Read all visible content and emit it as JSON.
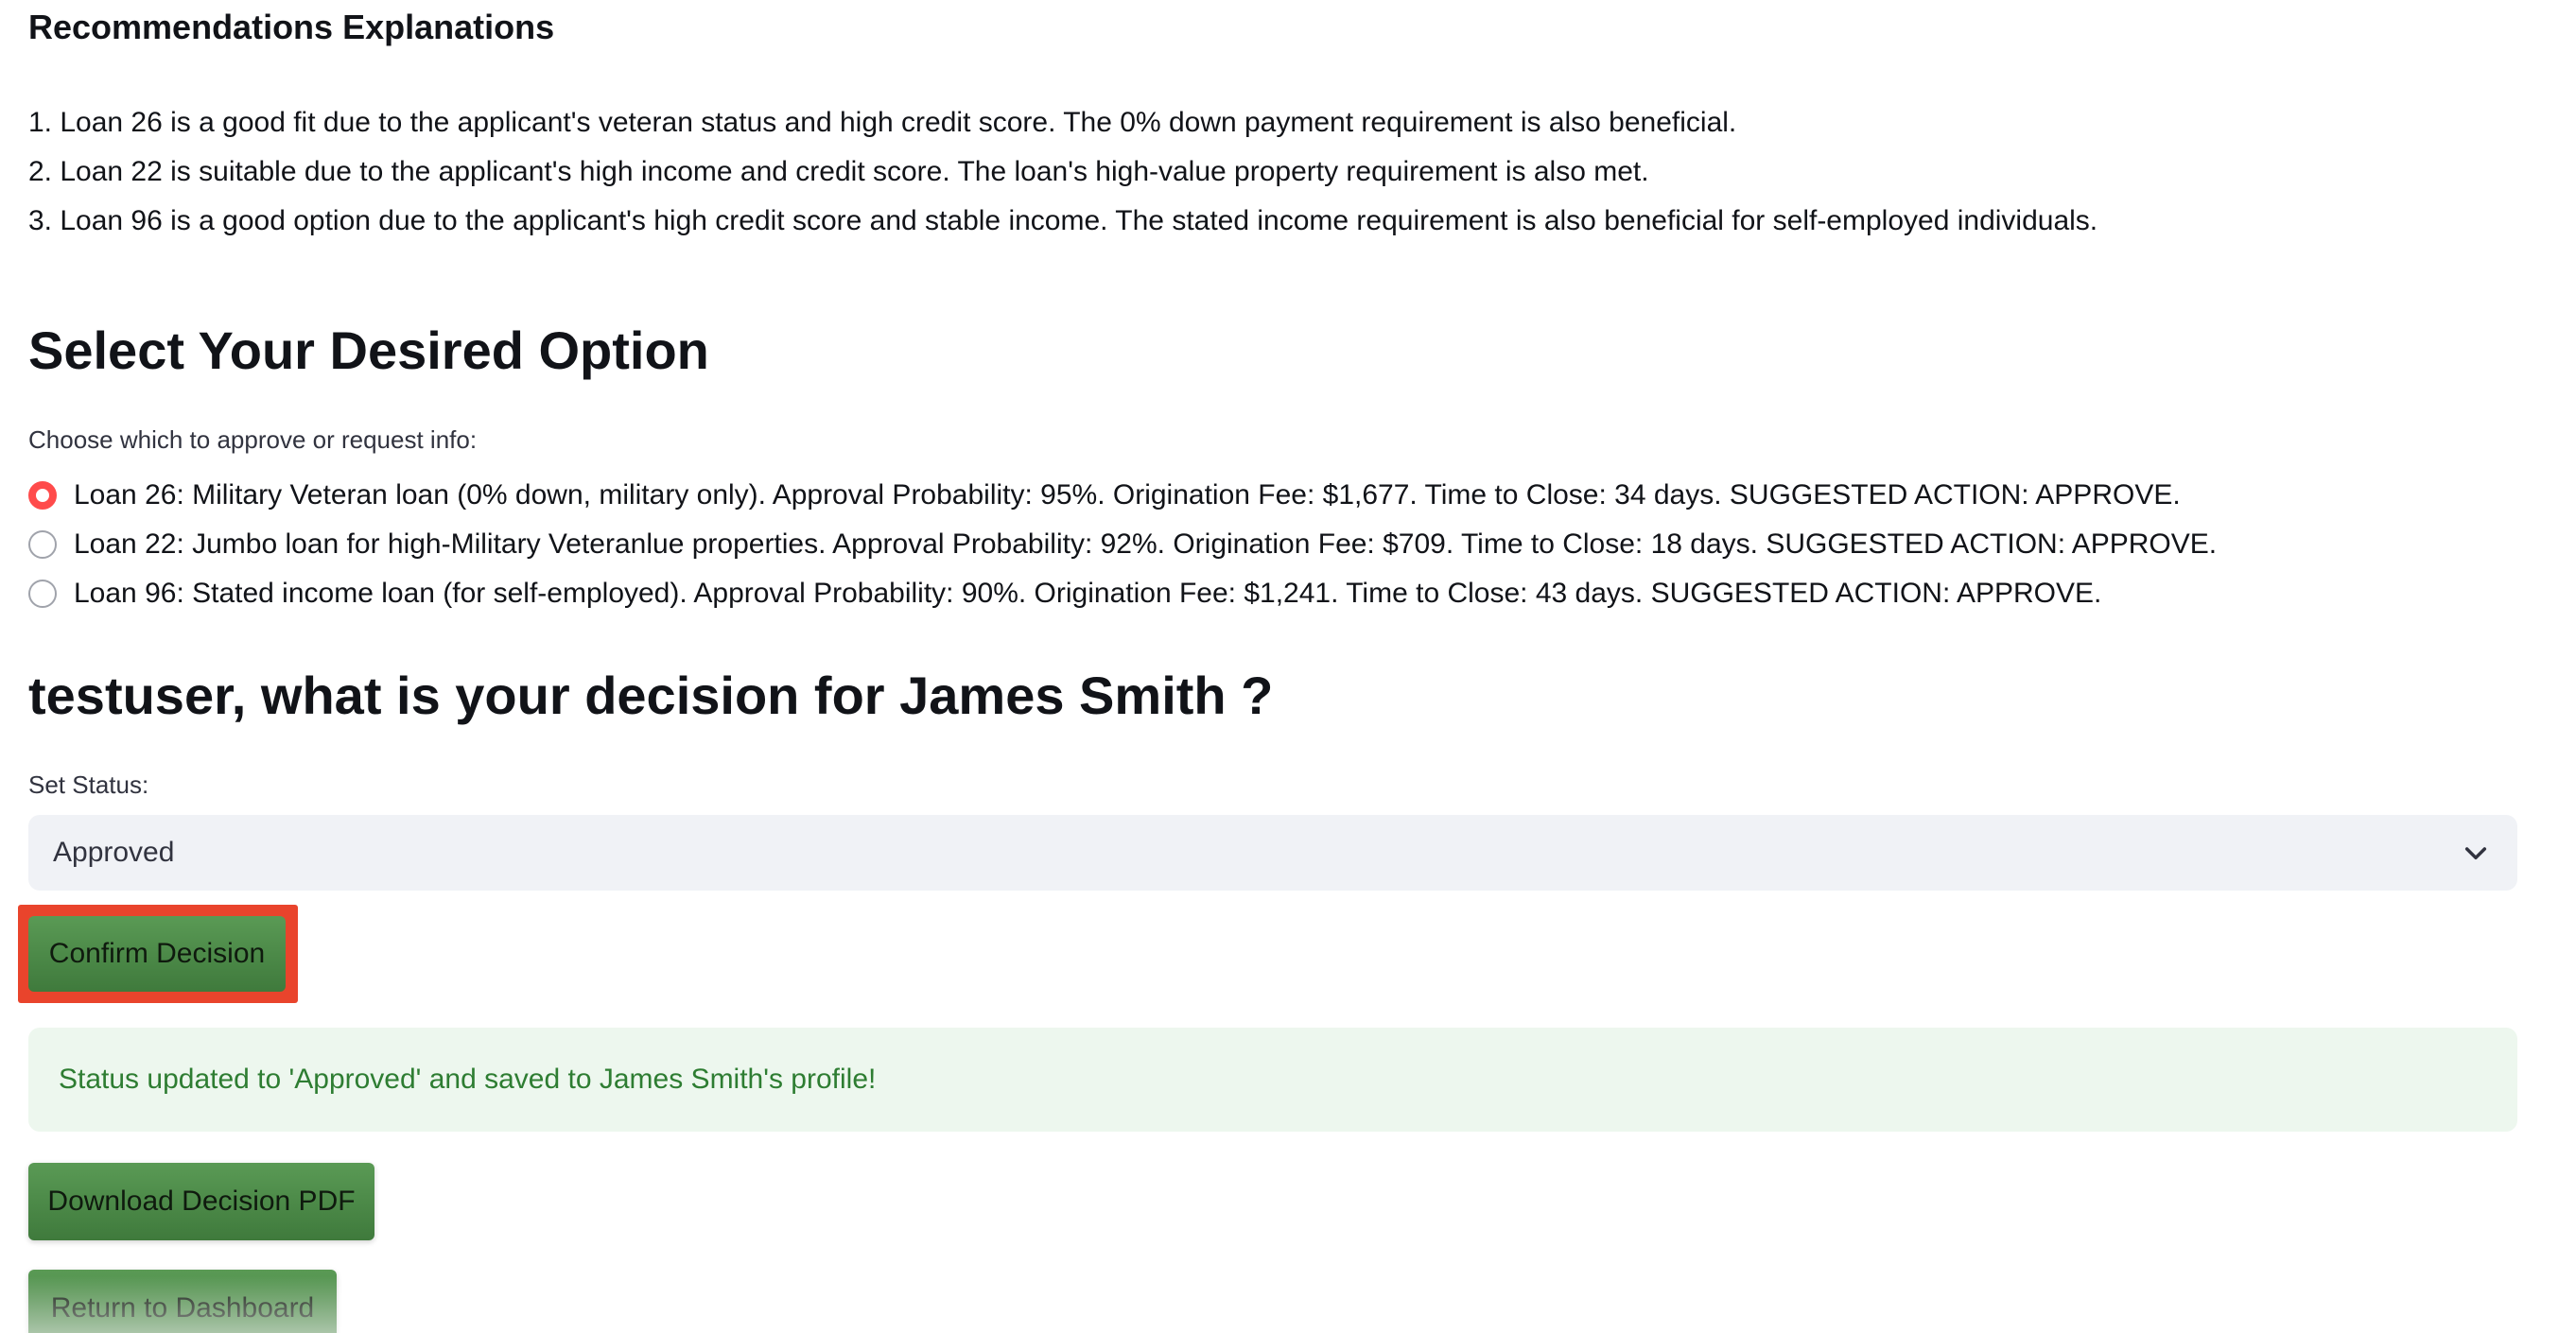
{
  "recommendations": {
    "heading": "Recommendations Explanations",
    "items": [
      "1. Loan 26 is a good fit due to the applicant's veteran status and high credit score. The 0% down payment requirement is also beneficial.",
      "2. Loan 22 is suitable due to the applicant's high income and credit score. The loan's high-value property requirement is also met.",
      "3. Loan 96 is a good option due to the applicant's high credit score and stable income. The stated income requirement is also beneficial for self-employed individuals."
    ]
  },
  "options": {
    "heading": "Select Your Desired Option",
    "radio_label": "Choose which to approve or request info:",
    "selected_index": 0,
    "items": [
      "Loan 26: Military Veteran loan (0% down, military only). Approval Probability: 95%. Origination Fee: $1,677. Time to Close: 34 days. SUGGESTED ACTION: APPROVE.",
      "Loan 22: Jumbo loan for high-Military Veteranlue properties. Approval Probability: 92%. Origination Fee: $709. Time to Close: 18 days. SUGGESTED ACTION: APPROVE.",
      "Loan 96: Stated income loan (for self-employed). Approval Probability: 90%. Origination Fee: $1,241. Time to Close: 43 days. SUGGESTED ACTION: APPROVE."
    ]
  },
  "decision": {
    "heading": "testuser, what is your decision for James Smith ?",
    "status_label": "Set Status:",
    "status_value": "Approved",
    "confirm_label": "Confirm Decision",
    "success_message": "Status updated to 'Approved' and saved to James Smith's profile!",
    "download_label": "Download Decision PDF",
    "return_label": "Return to Dashboard"
  },
  "icons": {
    "select_chevron": "chevron-down-icon"
  },
  "colors": {
    "radio_accent": "#ff4b4b",
    "button_green": "#4a8a46",
    "highlight_red": "#e9442c",
    "success_bg": "#edf7ee",
    "success_text": "#2e7d32"
  }
}
